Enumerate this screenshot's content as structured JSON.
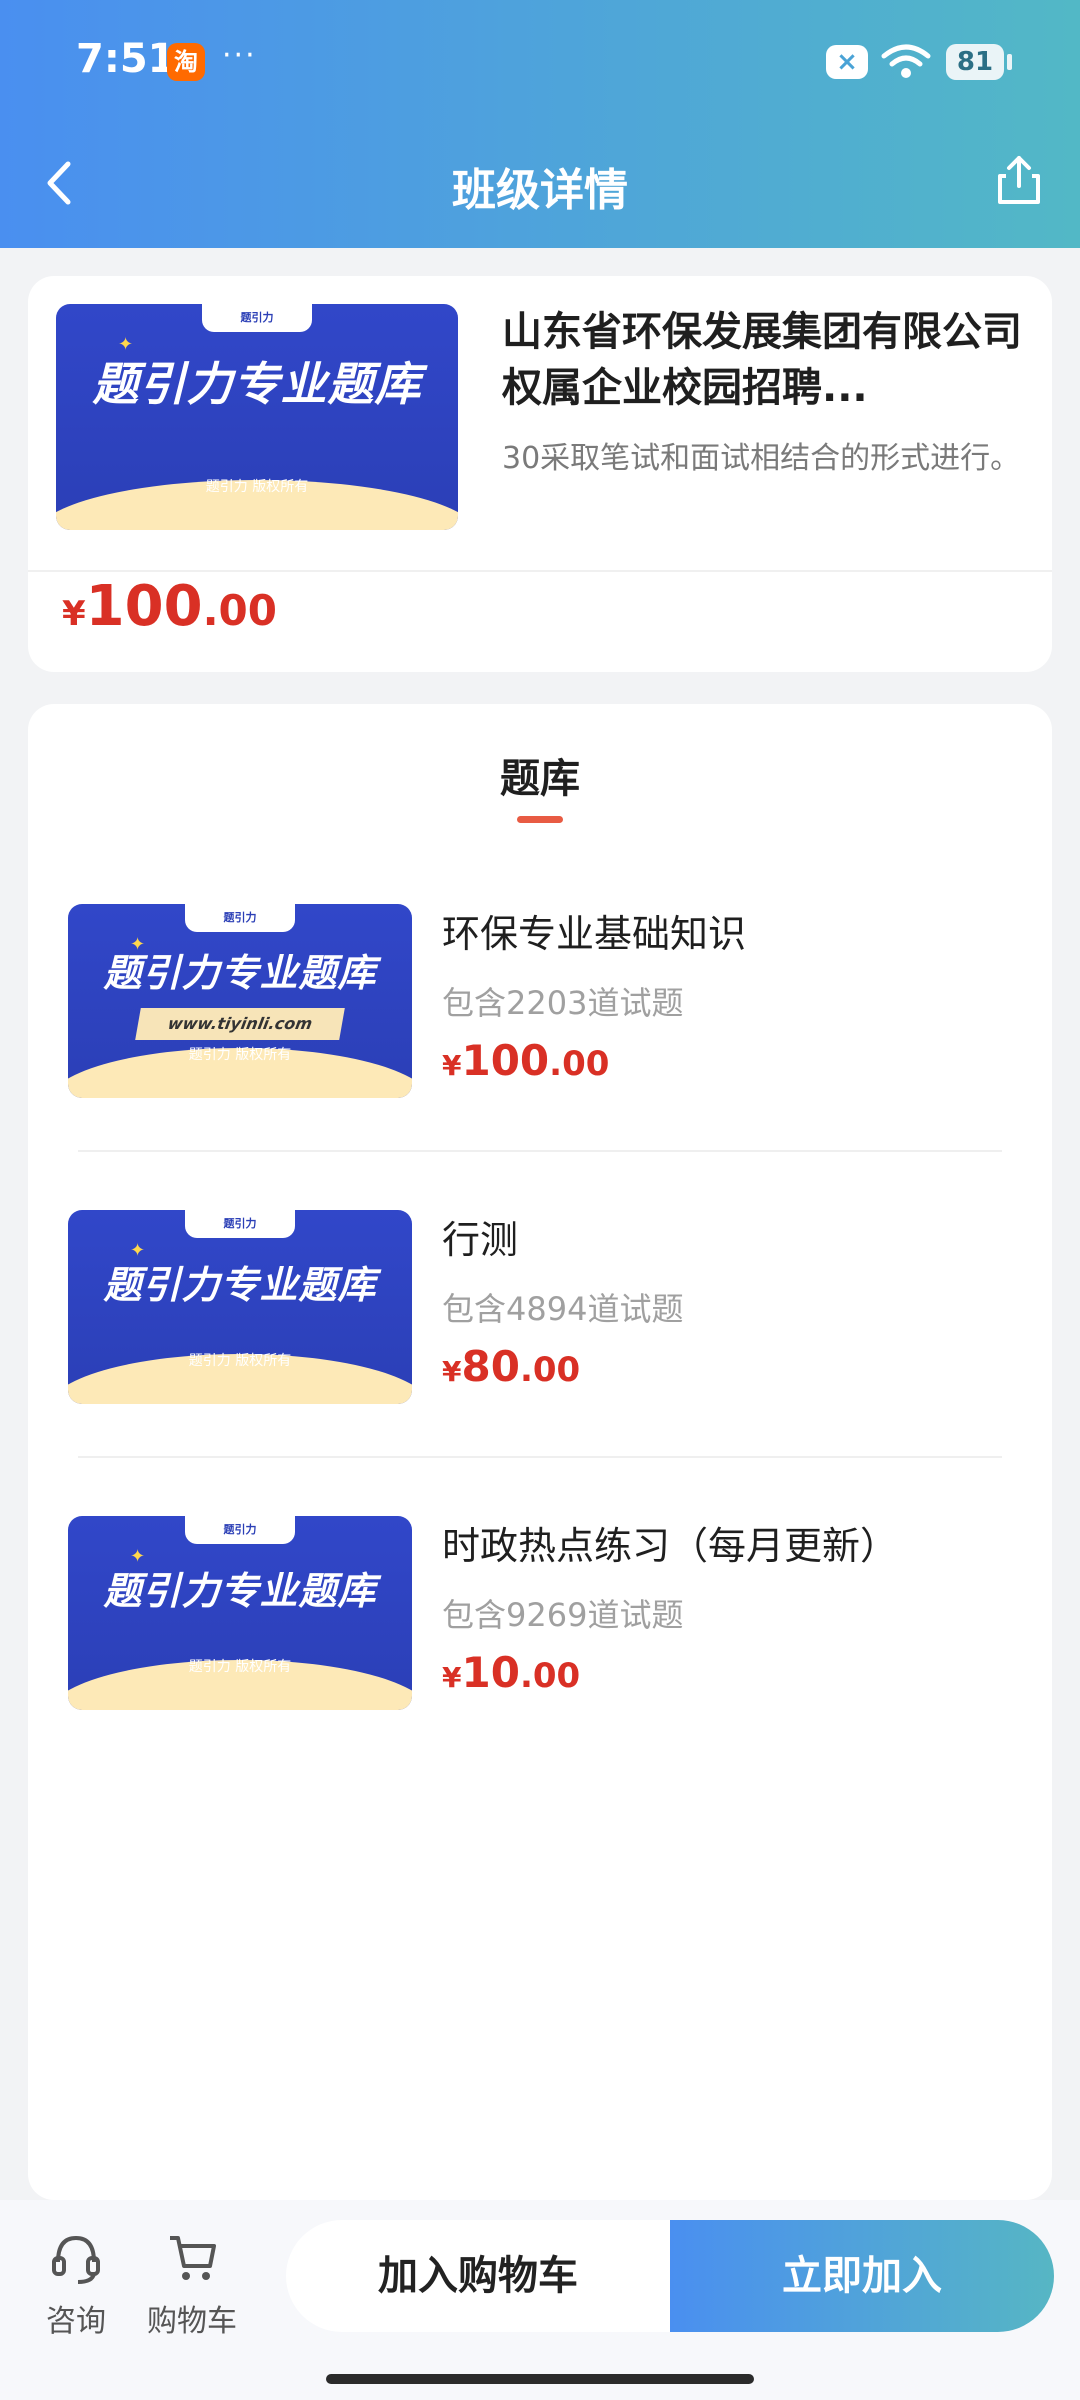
{
  "status": {
    "time": "7:51",
    "dots": "···",
    "sim": "×",
    "battery": "81"
  },
  "header": {
    "title": "班级详情"
  },
  "course": {
    "thumb": {
      "logo_text": "题引力",
      "title": "题引力专业题库",
      "owner": "题引力 版权所有"
    },
    "title": "山东省环保发展集团有限公司权属企业校园招聘...",
    "description": "30采取笔试和面试相结合的形式进行。",
    "price": {
      "currency": "¥",
      "integer": "100",
      "decimals": ".00"
    }
  },
  "question_bank": {
    "heading": "题库",
    "items": [
      {
        "thumb_title": "题引力专业题库",
        "thumb_url_text": "www.tiyinli.com",
        "thumb_owner": "题引力 版权所有",
        "name": "环保专业基础知识",
        "count": "包含2203道试题",
        "price": {
          "currency": "¥",
          "integer": "100",
          "decimals": ".00"
        }
      },
      {
        "thumb_title": "题引力专业题库",
        "thumb_owner": "题引力 版权所有",
        "name": "行测",
        "count": "包含4894道试题",
        "price": {
          "currency": "¥",
          "integer": "80",
          "decimals": ".00"
        }
      },
      {
        "thumb_title": "题引力专业题库",
        "thumb_owner": "题引力 版权所有",
        "name": "时政热点练习（每月更新）",
        "count": "包含9269道试题",
        "price": {
          "currency": "¥",
          "integer": "10",
          "decimals": ".00"
        }
      }
    ]
  },
  "bottom_bar": {
    "consult_label": "咨询",
    "cart_label": "购物车",
    "add_to_cart": "加入购物车",
    "join_now": "立即加入"
  },
  "colors": {
    "header_start": "#4a8ff0",
    "header_end": "#52b8c6",
    "price_red": "#d93025",
    "tab_underline": "#e85b43"
  }
}
